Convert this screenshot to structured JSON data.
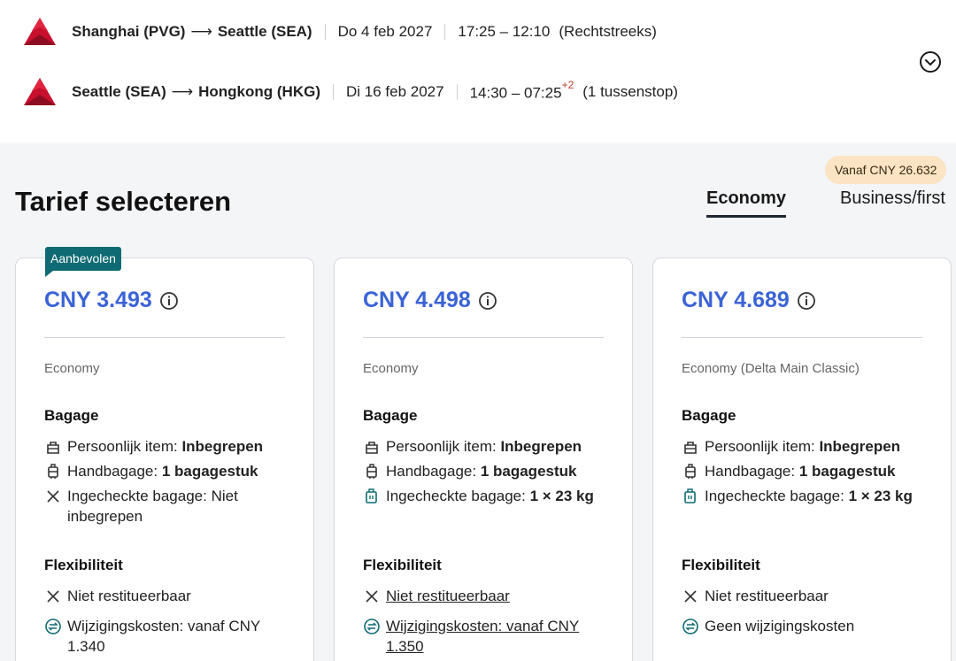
{
  "flights": [
    {
      "origin": "Shanghai (PVG)",
      "destination": "Seattle (SEA)",
      "date": "Do 4 feb 2027",
      "times": "17:25 – 12:10",
      "day_offset": "",
      "note": "(Rechtstreeks)"
    },
    {
      "origin": "Seattle (SEA)",
      "destination": "Hongkong (HKG)",
      "date": "Di 16 feb 2027",
      "times": "14:30 – 07:25",
      "day_offset": "+2",
      "note": "(1 tussenstop)"
    }
  ],
  "arrow": "⟶",
  "heading": "Tarief selecteren",
  "from_badge": "Vanaf CNY 26.632",
  "tabs": {
    "active": "Economy",
    "inactive": "Business/first"
  },
  "cards": [
    {
      "badge": "Aanbevolen",
      "price": "CNY 3.493",
      "cabin": "Economy",
      "baggage_title": "Bagage",
      "personal_label": "Persoonlijk item: ",
      "personal_value": "Inbegrepen",
      "carryon_label": "Handbagage: ",
      "carryon_value": "1 bagagestuk",
      "checked_label": "Ingecheckte bagage: Niet inbegrepen",
      "checked_value": "",
      "flex_title": "Flexibiliteit",
      "refund": "Niet restitueerbaar",
      "change": "Wijzigingskosten: vanaf CNY 1.340"
    },
    {
      "badge": "",
      "price": "CNY 4.498",
      "cabin": "Economy",
      "baggage_title": "Bagage",
      "personal_label": "Persoonlijk item: ",
      "personal_value": "Inbegrepen",
      "carryon_label": "Handbagage: ",
      "carryon_value": "1 bagagestuk",
      "checked_label": "Ingecheckte bagage: ",
      "checked_value": "1 × 23 kg",
      "flex_title": "Flexibiliteit",
      "refund": "Niet restitueerbaar",
      "change": "Wijzigingskosten: vanaf CNY 1.350"
    },
    {
      "badge": "",
      "price": "CNY 4.689",
      "cabin": "Economy (Delta Main Classic)",
      "baggage_title": "Bagage",
      "personal_label": "Persoonlijk item: ",
      "personal_value": "Inbegrepen",
      "carryon_label": "Handbagage: ",
      "carryon_value": "1 bagagestuk",
      "checked_label": "Ingecheckte bagage: ",
      "checked_value": "1 × 23 kg",
      "flex_title": "Flexibiliteit",
      "refund": "Niet restitueerbaar",
      "change": "Geen wijzigingskosten"
    }
  ],
  "icons": {
    "logo": "delta-logo-icon",
    "expand": "chevron-down-circle-icon",
    "info": "info-icon",
    "personal_item": "bag-icon",
    "carry_on": "suitcase-icon",
    "checked_included": "luggage-icon",
    "not_included": "close-icon",
    "change": "exchange-icon"
  },
  "colors": {
    "price": "#3b63d6",
    "badge": "#0f6b73",
    "from_badge": "#fbe4c4",
    "logo": "#c8102e"
  }
}
